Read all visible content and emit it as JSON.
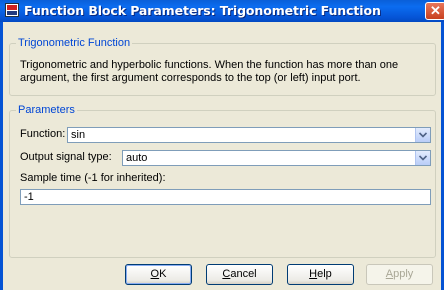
{
  "window": {
    "title": "Function Block Parameters: Trigonometric Function",
    "close_glyph": "✕"
  },
  "description_group": {
    "legend": "Trigonometric Function",
    "text": "Trigonometric and hyperbolic functions. When the function has more than one argument, the first argument corresponds to the top (or left) input port."
  },
  "parameters_group": {
    "legend": "Parameters",
    "function": {
      "label": "Function:",
      "value": "sin"
    },
    "output_signal_type": {
      "label": "Output signal type:",
      "value": "auto"
    },
    "sample_time": {
      "label": "Sample time (-1 for inherited):",
      "value": "-1"
    }
  },
  "buttons": {
    "ok": {
      "mnemonic": "O",
      "rest": "K"
    },
    "cancel": {
      "mnemonic": "C",
      "rest": "ancel"
    },
    "help": {
      "mnemonic": "H",
      "rest": "elp"
    },
    "apply": {
      "mnemonic": "A",
      "rest": "pply",
      "enabled": false
    }
  },
  "colors": {
    "titlebar": "#0554d6",
    "dialog_background": "#ece9d8",
    "group_legend": "#0046d5",
    "control_border": "#7f9db9"
  },
  "icons": [
    "simulink-block-icon",
    "close-icon",
    "chevron-down-icon"
  ]
}
